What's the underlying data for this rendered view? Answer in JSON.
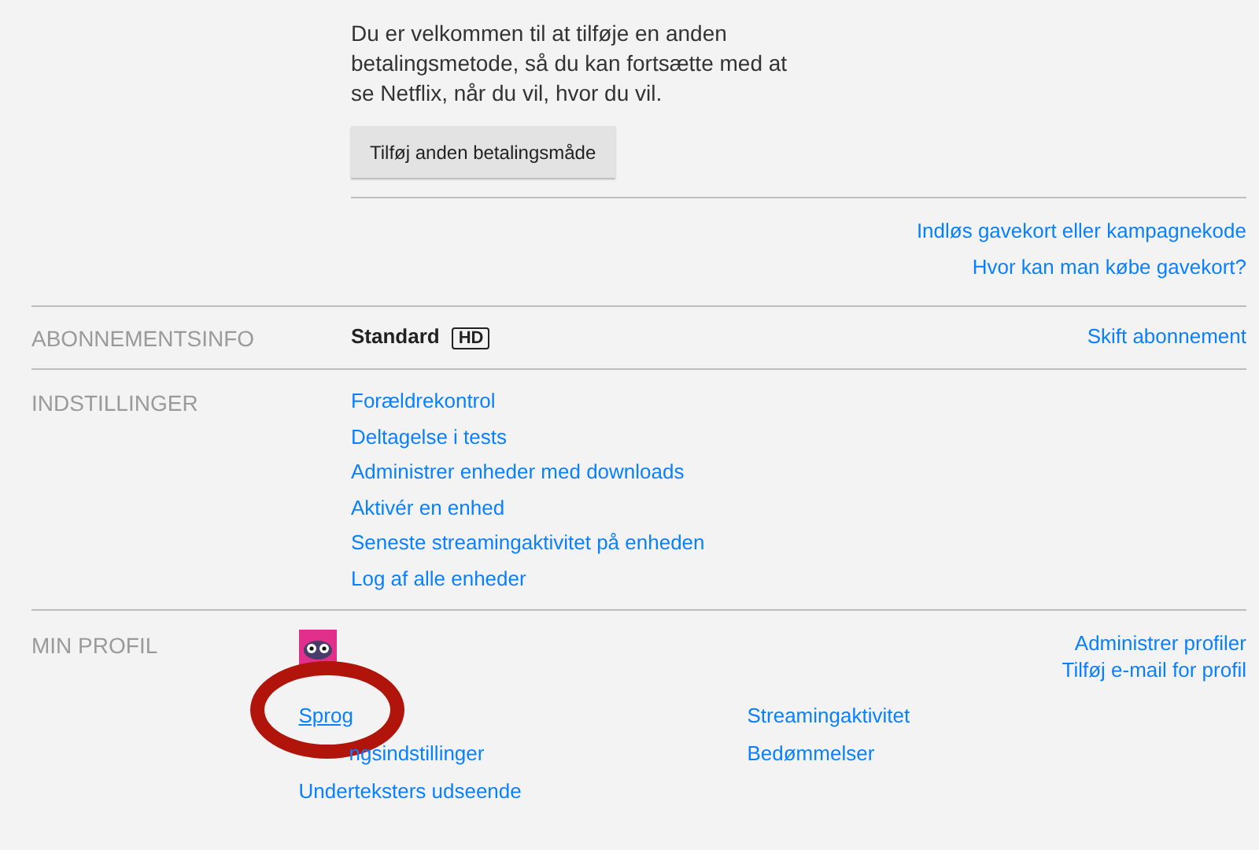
{
  "payment": {
    "message": "Du er velkommen til at tilføje en anden betalingsmetode, så du kan fortsætte med at se Netflix, når du vil, hvor du vil.",
    "button": "Tilføj anden betalingsmåde",
    "links": [
      "Indløs gavekort eller kampagnekode",
      "Hvor kan man købe gavekort?"
    ]
  },
  "plan": {
    "label": "ABONNEMENTSINFO",
    "name": "Standard",
    "badge": "HD",
    "link": "Skift abonnement"
  },
  "settings": {
    "label": "INDSTILLINGER",
    "links": [
      "Forældrekontrol",
      "Deltagelse i tests",
      "Administrer enheder med downloads",
      "Aktivér en enhed",
      "Seneste streamingaktivitet på enheden",
      "Log af alle enheder"
    ]
  },
  "profile": {
    "label": "MIN PROFIL",
    "right_links": [
      "Administrer profiler",
      "Tilføj e-mail for profil"
    ],
    "left_links": [
      {
        "text": "Sprog",
        "circled": true
      },
      {
        "text": "ngsindstillinger",
        "circled": false
      },
      {
        "text": "Underteksters udseende",
        "circled": false
      }
    ],
    "middle_links": [
      "Streamingaktivitet",
      "Bedømmelser"
    ]
  }
}
